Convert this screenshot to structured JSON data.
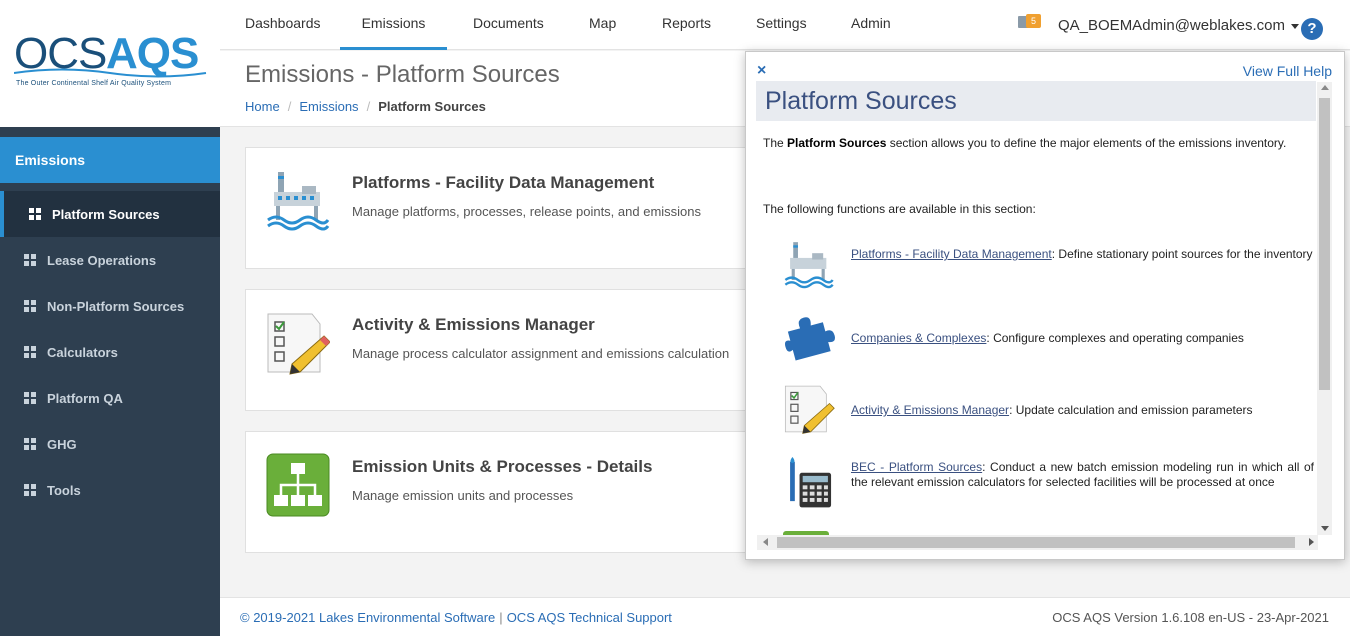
{
  "brand": {
    "logo_prefix": "OCS",
    "logo_suffix": "AQS",
    "tagline": "The Outer Continental Shelf Air Quality System"
  },
  "sidebar": {
    "section": "Emissions",
    "items": [
      {
        "label": "Platform Sources",
        "active": true
      },
      {
        "label": "Lease Operations"
      },
      {
        "label": "Non-Platform Sources"
      },
      {
        "label": "Calculators"
      },
      {
        "label": "Platform QA"
      },
      {
        "label": "GHG"
      },
      {
        "label": "Tools"
      }
    ]
  },
  "nav": {
    "items": [
      "Dashboards",
      "Emissions",
      "Documents",
      "Map",
      "Reports",
      "Settings",
      "Admin"
    ],
    "active": "Emissions",
    "mail_count": "5",
    "user": "QA_BOEMAdmin@weblakes.com",
    "help_label": "?"
  },
  "page": {
    "title": "Emissions - Platform Sources",
    "breadcrumb": [
      "Home",
      "Emissions",
      "Platform Sources"
    ]
  },
  "cards": [
    {
      "title": "Platforms - Facility Data Management",
      "desc": "Manage platforms, processes, release points, and emissions",
      "icon": "platform-icon"
    },
    {
      "title": "Activity & Emissions Manager",
      "desc": "Manage process calculator assignment and emissions calculation",
      "icon": "checklist-pencil-icon"
    },
    {
      "title": "Emission Units & Processes - Details",
      "desc": "Manage emission units and processes",
      "icon": "hierarchy-icon"
    }
  ],
  "help": {
    "close": "×",
    "full_help": "View Full Help",
    "title": "Platform Sources",
    "intro_prefix": "The ",
    "intro_bold": "Platform Sources",
    "intro_suffix": " section allows you to define the major elements of the emissions inventory.",
    "functions_intro": "The following functions are available in this section:",
    "functions": [
      {
        "link": "Platforms - Facility Data Management",
        "text": ": Define stationary point sources for the inventory",
        "icon": "platform-icon"
      },
      {
        "link": "Companies & Complexes",
        "text": ": Configure complexes and operating companies",
        "icon": "puzzle-icon"
      },
      {
        "link": "Activity & Emissions Manager",
        "text": ": Update calculation and emission parameters",
        "icon": "checklist-pencil-icon"
      },
      {
        "link": "BEC - Platform Sources",
        "text": ": Conduct a new batch emission modeling run in which all of the relevant emission calculators for selected facilities will be processed at once",
        "icon": "calculator-icon"
      }
    ]
  },
  "footer": {
    "copyright": "© 2019-2021 Lakes Environmental Software",
    "separator": "|",
    "support": "OCS AQS Technical Support",
    "version": "OCS AQS Version 1.6.108 en-US - 23-Apr-2021"
  },
  "colors": {
    "accent": "#2a8fd1",
    "sidebar_bg": "#2e3f50",
    "link": "#2a6db5"
  }
}
